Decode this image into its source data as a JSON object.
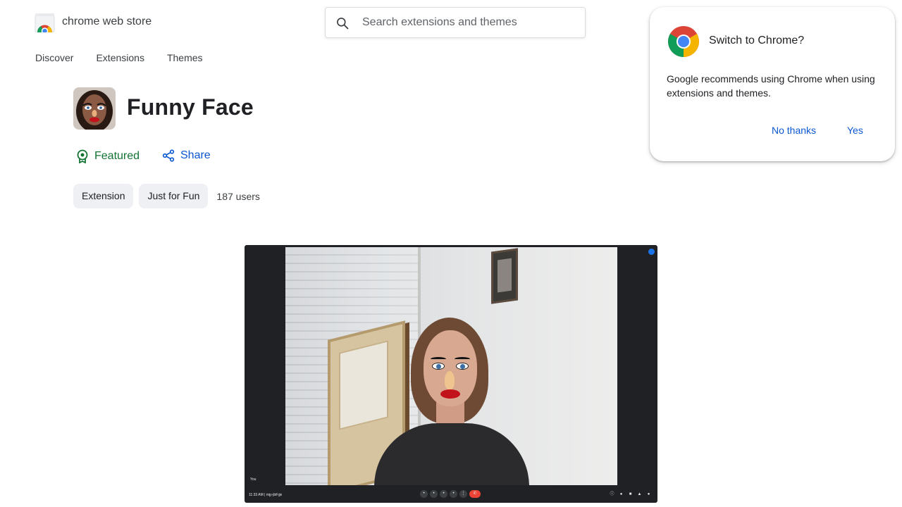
{
  "header": {
    "brand": "chrome web store",
    "search": {
      "placeholder": "Search extensions and themes",
      "value": ""
    }
  },
  "nav": [
    "Discover",
    "Extensions",
    "Themes"
  ],
  "item": {
    "title": "Funny Face",
    "featured": "Featured",
    "share": "Share",
    "chips": [
      "Extension",
      "Just for Fun"
    ],
    "users": "187 users"
  },
  "screenshot": {
    "you_tag": "You",
    "bar_left": "11:33 AM  |  mjy-jbif-jje"
  },
  "popup": {
    "title": "Switch to Chrome?",
    "body": "Google recommends using Chrome when using extensions and themes.",
    "no_thanks": "No thanks",
    "yes": "Yes"
  },
  "colors": {
    "featured_green": "#137333",
    "link_blue": "#0b57d0",
    "chip_bg": "#eef0f4"
  }
}
